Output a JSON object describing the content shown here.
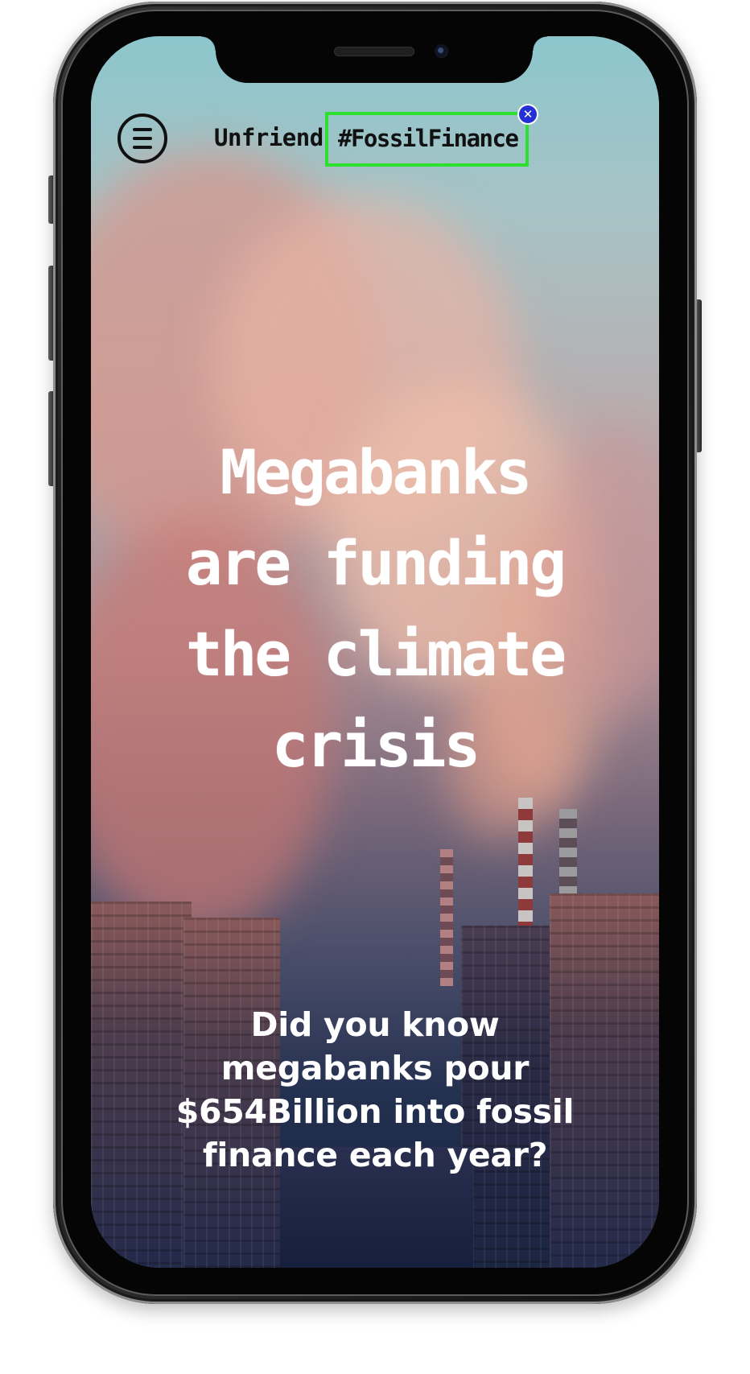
{
  "header": {
    "menu_icon": "hamburger-menu-icon",
    "brand_word": "Unfriend",
    "hashtag": "#FossilFinance",
    "close_icon": "close-x-icon"
  },
  "hero": {
    "headline_lines": [
      "Megabanks",
      "are funding",
      "the climate",
      "crisis"
    ]
  },
  "fact": {
    "lines": [
      "Did you know",
      "megabanks pour",
      "$654Billion into fossil",
      "finance each year?"
    ]
  },
  "colors": {
    "highlight_border": "#2ee02e",
    "close_badge": "#2430d6",
    "text_light": "#ffffff",
    "text_dark": "#111111"
  }
}
